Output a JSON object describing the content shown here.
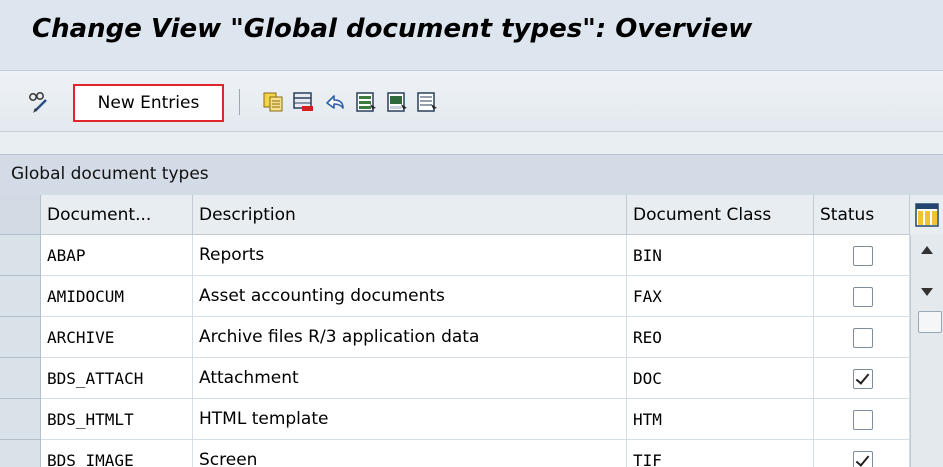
{
  "title": "Change View \"Global document types\": Overview",
  "toolbar": {
    "new_entries_label": "New Entries",
    "icons": [
      "pencil-glasses-icon",
      "copy-icon",
      "delete-icon",
      "undo-icon",
      "select-all-icon",
      "select-block-icon",
      "deselect-all-icon"
    ]
  },
  "section": {
    "title": "Global document types"
  },
  "table": {
    "columns": [
      "Document...",
      "Description",
      "Document Class",
      "Status"
    ],
    "rows": [
      {
        "doc": "ABAP",
        "desc": "Reports",
        "cls": "BIN",
        "status": false
      },
      {
        "doc": "AMIDOCUM",
        "desc": "Asset accounting documents",
        "cls": "FAX",
        "status": false
      },
      {
        "doc": "ARCHIVE",
        "desc": "Archive files R/3 application data",
        "cls": "REO",
        "status": false
      },
      {
        "doc": "BDS_ATTACH",
        "desc": "Attachment",
        "cls": "DOC",
        "status": true
      },
      {
        "doc": "BDS_HTMLT",
        "desc": "HTML template",
        "cls": "HTM",
        "status": false
      },
      {
        "doc": "BDS_IMAGE",
        "desc": "Screen",
        "cls": "TIF",
        "status": true
      }
    ]
  },
  "colors": {
    "highlight": "#e0262a",
    "title_bg": "#dde5ee"
  }
}
